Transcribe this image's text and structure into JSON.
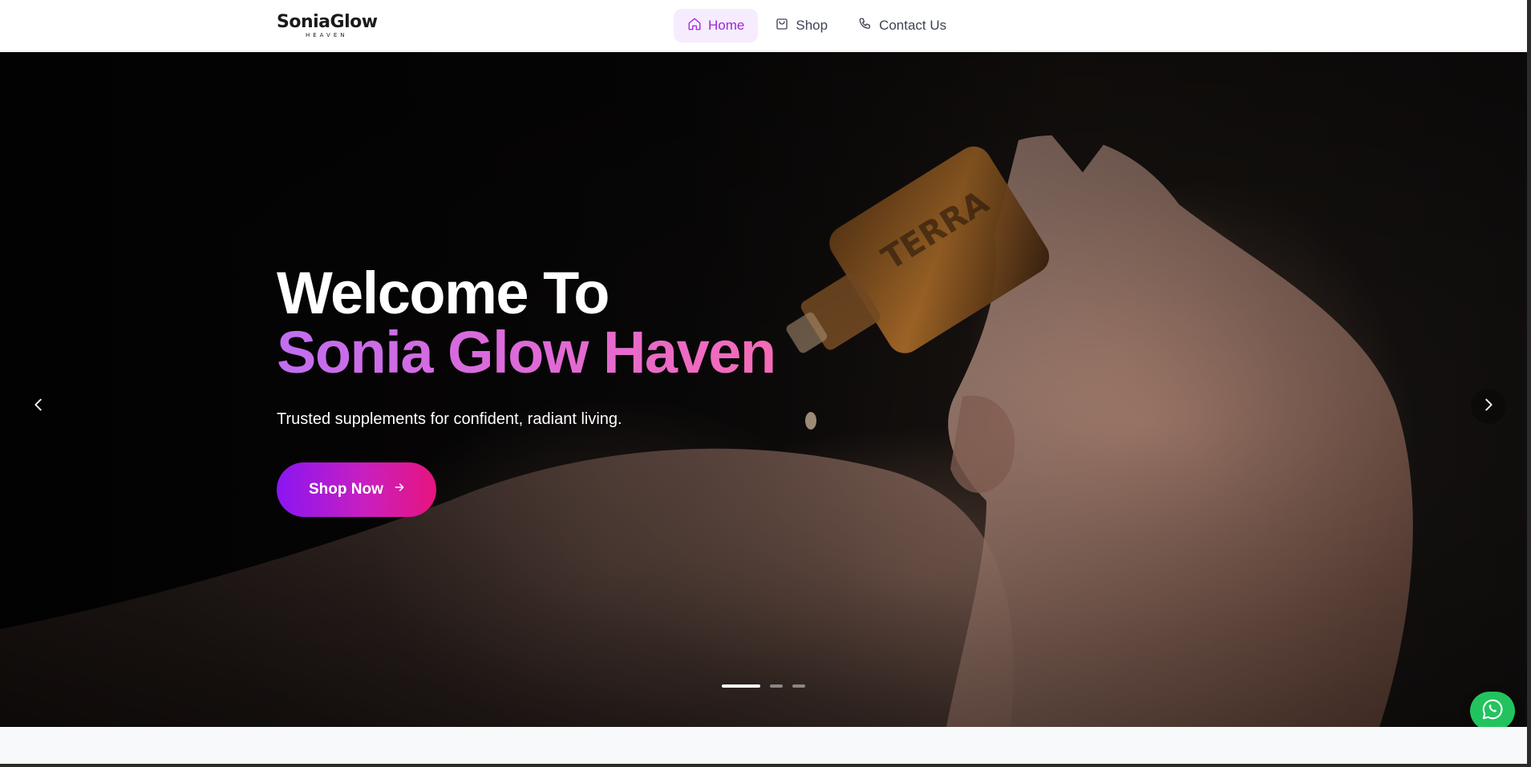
{
  "brand": {
    "name": "SoniaGlow",
    "tagline": "HEAVEN"
  },
  "nav": {
    "items": [
      {
        "label": "Home",
        "icon": "home-icon",
        "active": true
      },
      {
        "label": "Shop",
        "icon": "shopping-bag-icon",
        "active": false
      },
      {
        "label": "Contact Us",
        "icon": "phone-icon",
        "active": false
      }
    ]
  },
  "hero": {
    "title_line1": "Welcome To",
    "title_line2": "Sonia Glow Haven",
    "subtitle": "Trusted supplements for confident, radiant living.",
    "cta_label": "Shop Now",
    "slides": {
      "count": 3,
      "active": 1
    }
  },
  "colors": {
    "accent_purple": "#9d26d9",
    "gradient_start": "#8a16f2",
    "gradient_end": "#e8147e",
    "whatsapp_green": "#22c35e"
  }
}
